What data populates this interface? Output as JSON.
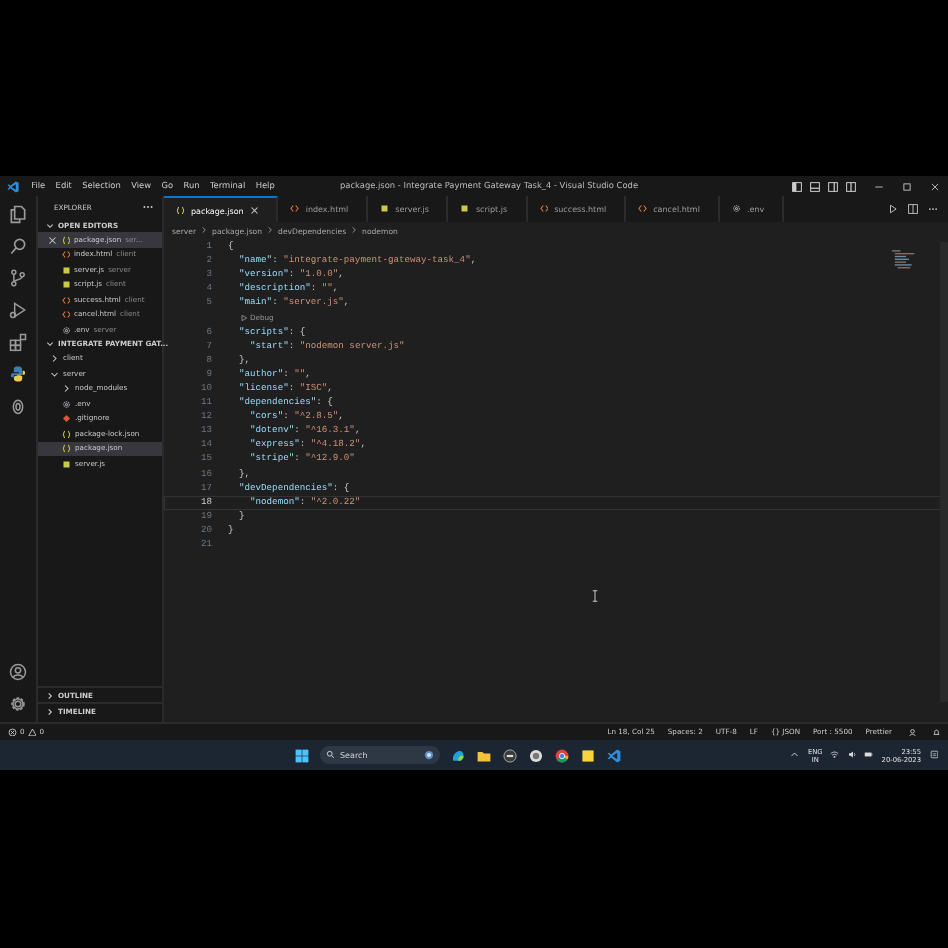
{
  "window": {
    "title": "package.json - Integrate Payment Gateway Task_4 - Visual Studio Code"
  },
  "menu": [
    "File",
    "Edit",
    "Selection",
    "View",
    "Go",
    "Run",
    "Terminal",
    "Help"
  ],
  "activity_bar": [
    {
      "kind": "files"
    },
    {
      "kind": "search"
    },
    {
      "kind": "source-control"
    },
    {
      "kind": "run"
    },
    {
      "kind": "extensions"
    },
    {
      "kind": "python"
    },
    {
      "kind": "oval"
    }
  ],
  "tabs": [
    {
      "label": "package.json",
      "kind": "json",
      "selected": true
    },
    {
      "label": "index.html",
      "kind": "html",
      "selected": false
    },
    {
      "label": "server.js",
      "kind": "js",
      "selected": false
    },
    {
      "label": "script.js",
      "kind": "js",
      "selected": false
    },
    {
      "label": "success.html",
      "kind": "html",
      "selected": false
    },
    {
      "label": "cancel.html",
      "kind": "html",
      "selected": false
    },
    {
      "label": ".env",
      "kind": "env",
      "selected": false
    }
  ],
  "breadcrumb": [
    "server",
    "package.json",
    "devDependencies",
    "nodemon"
  ],
  "explorer": {
    "title": "EXPLORER",
    "open_editors": {
      "title": "OPEN EDITORS",
      "items": [
        {
          "name": "package.json",
          "folder": "ser...",
          "kind": "json",
          "selected": true
        },
        {
          "name": "index.html",
          "folder": "client",
          "kind": "html",
          "selected": false
        },
        {
          "name": "server.js",
          "folder": "server",
          "kind": "js",
          "selected": false
        },
        {
          "name": "script.js",
          "folder": "client",
          "kind": "js",
          "selected": false
        },
        {
          "name": "success.html",
          "folder": "client",
          "kind": "html",
          "selected": false
        },
        {
          "name": "cancel.html",
          "folder": "client",
          "kind": "html",
          "selected": false
        },
        {
          "name": ".env",
          "folder": "server",
          "kind": "env",
          "selected": false
        }
      ]
    },
    "folder": {
      "title": "INTEGRATE PAYMENT GAT...",
      "items": [
        {
          "name": "client",
          "kind": "folder",
          "expanded": false,
          "selected": false
        },
        {
          "name": "server",
          "kind": "folder",
          "expanded": true,
          "selected": false,
          "children": [
            {
              "name": "node_modules",
              "kind": "folder",
              "expanded": false,
              "selected": false
            },
            {
              "name": ".env",
              "kind": "env",
              "selected": false
            },
            {
              "name": ".gitignore",
              "kind": "git",
              "selected": false
            },
            {
              "name": "package-lock.json",
              "kind": "json",
              "selected": false
            },
            {
              "name": "package.json",
              "kind": "json",
              "selected": true
            },
            {
              "name": "server.js",
              "kind": "js",
              "selected": false
            }
          ]
        }
      ]
    },
    "sections": [
      "OUTLINE",
      "TIMELINE"
    ]
  },
  "editor": {
    "lines": [
      {
        "kind": "code",
        "number": "1",
        "text": "{",
        "current": false
      },
      {
        "kind": "code",
        "number": "2",
        "text": "  \"name\": \"integrate-payment-gateway-task_4\",",
        "current": false
      },
      {
        "kind": "code",
        "number": "3",
        "text": "  \"version\": \"1.0.0\",",
        "current": false
      },
      {
        "kind": "code",
        "number": "4",
        "text": "  \"description\": \"\",",
        "current": false
      },
      {
        "kind": "code",
        "number": "5",
        "text": "  \"main\": \"server.js\",",
        "current": false
      },
      {
        "kind": "codelens",
        "text": "Debug"
      },
      {
        "kind": "code",
        "number": "6",
        "text": "  \"scripts\": {",
        "current": false
      },
      {
        "kind": "code",
        "number": "7",
        "text": "    \"start\": \"nodemon server.js\"",
        "current": false
      },
      {
        "kind": "code",
        "number": "8",
        "text": "  },",
        "current": false
      },
      {
        "kind": "code",
        "number": "9",
        "text": "  \"author\": \"\",",
        "current": false
      },
      {
        "kind": "code",
        "number": "10",
        "text": "  \"license\": \"ISC\",",
        "current": false
      },
      {
        "kind": "code",
        "number": "11",
        "text": "  \"dependencies\": {",
        "current": false
      },
      {
        "kind": "code",
        "number": "12",
        "text": "    \"cors\": \"^2.8.5\",",
        "current": false
      },
      {
        "kind": "code",
        "number": "13",
        "text": "    \"dotenv\": \"^16.3.1\",",
        "current": false
      },
      {
        "kind": "code",
        "number": "14",
        "text": "    \"express\": \"^4.18.2\",",
        "current": false
      },
      {
        "kind": "code",
        "number": "15",
        "text": "    \"stripe\": \"^12.9.0\"",
        "current": false
      },
      {
        "kind": "code",
        "number": "16",
        "text": "  },",
        "current": false
      },
      {
        "kind": "code",
        "number": "17",
        "text": "  \"devDependencies\": {",
        "current": false
      },
      {
        "kind": "code",
        "number": "18",
        "text": "    \"nodemon\": \"^2.0.22\"",
        "current": true
      },
      {
        "kind": "code",
        "number": "19",
        "text": "  }",
        "current": false
      },
      {
        "kind": "code",
        "number": "20",
        "text": "}",
        "current": false
      },
      {
        "kind": "code",
        "number": "21",
        "current": false
      }
    ]
  },
  "status_bar": {
    "errors": "0",
    "warnings": "0",
    "items": [
      "Ln 18, Col 25",
      "Spaces: 2",
      "UTF-8",
      "LF",
      "{} JSON",
      "Port : 5500",
      "Prettier"
    ]
  },
  "taskbar": {
    "search_placeholder": "Search",
    "language": "ENG",
    "region": "IN",
    "time": "23:55",
    "date": "20-06-2023"
  }
}
